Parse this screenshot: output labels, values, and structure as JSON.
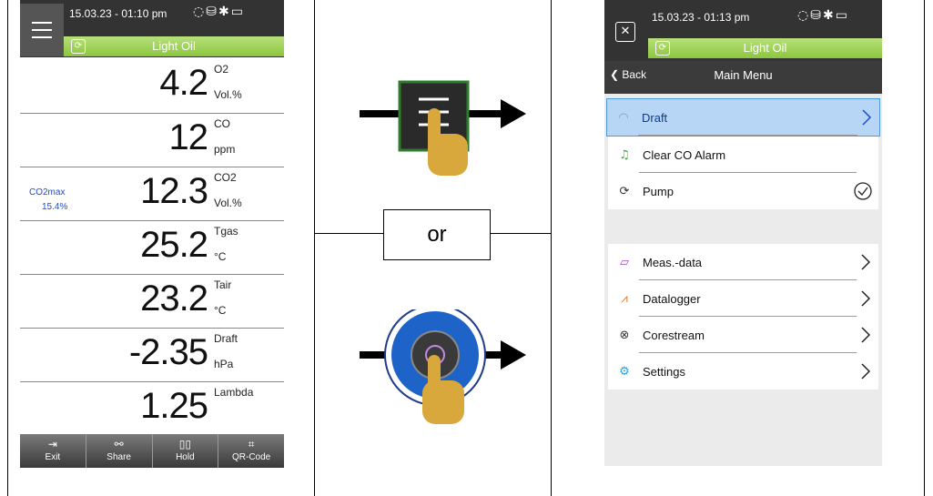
{
  "colors": {
    "green": "#8cc63e",
    "dark": "#333333",
    "blue": "#1a4bd6",
    "highlight": "#b7d6f5"
  },
  "left": {
    "timestamp": "15.03.23 - 01:10 pm",
    "title": "Light Oil",
    "side_label_1": "CO2max",
    "side_label_2": "15.4%",
    "rows": [
      {
        "value": "4.2",
        "name": "O2",
        "unit": "Vol.%"
      },
      {
        "value": "12",
        "name": "CO",
        "unit": "ppm"
      },
      {
        "value": "12.3",
        "name": "CO2",
        "unit": "Vol.%"
      },
      {
        "value": "25.2",
        "name": "Tgas",
        "unit": "°C"
      },
      {
        "value": "23.2",
        "name": "Tair",
        "unit": "°C"
      },
      {
        "value": "-2.35",
        "name": "Draft",
        "unit": "hPa"
      },
      {
        "value": "1.25",
        "name": "Lambda",
        "unit": ""
      }
    ],
    "bottom": [
      {
        "label": "Exit",
        "icon": "exit-icon"
      },
      {
        "label": "Share",
        "icon": "share-icon"
      },
      {
        "label": "Hold",
        "icon": "pause-icon"
      },
      {
        "label": "QR-Code",
        "icon": "qr-code-icon"
      }
    ]
  },
  "middle": {
    "or_label": "or"
  },
  "right": {
    "timestamp": "15.03.23 - 01:13 pm",
    "title": "Light Oil",
    "back_label": "Back",
    "nav_title": "Main Menu",
    "group1": [
      {
        "label": "Draft",
        "icon": "gauge-icon",
        "trail": "chevron"
      },
      {
        "label": "Clear CO Alarm",
        "icon": "bell-icon",
        "trail": "none"
      },
      {
        "label": "Pump",
        "icon": "pump-icon",
        "trail": "check"
      }
    ],
    "group2": [
      {
        "label": "Meas.-data",
        "icon": "folder-icon",
        "trail": "chevron"
      },
      {
        "label": "Datalogger",
        "icon": "chart-icon",
        "trail": "chevron"
      },
      {
        "label": "Corestream",
        "icon": "close-circle-icon",
        "trail": "chevron"
      },
      {
        "label": "Settings",
        "icon": "gears-icon",
        "trail": "chevron"
      }
    ]
  }
}
